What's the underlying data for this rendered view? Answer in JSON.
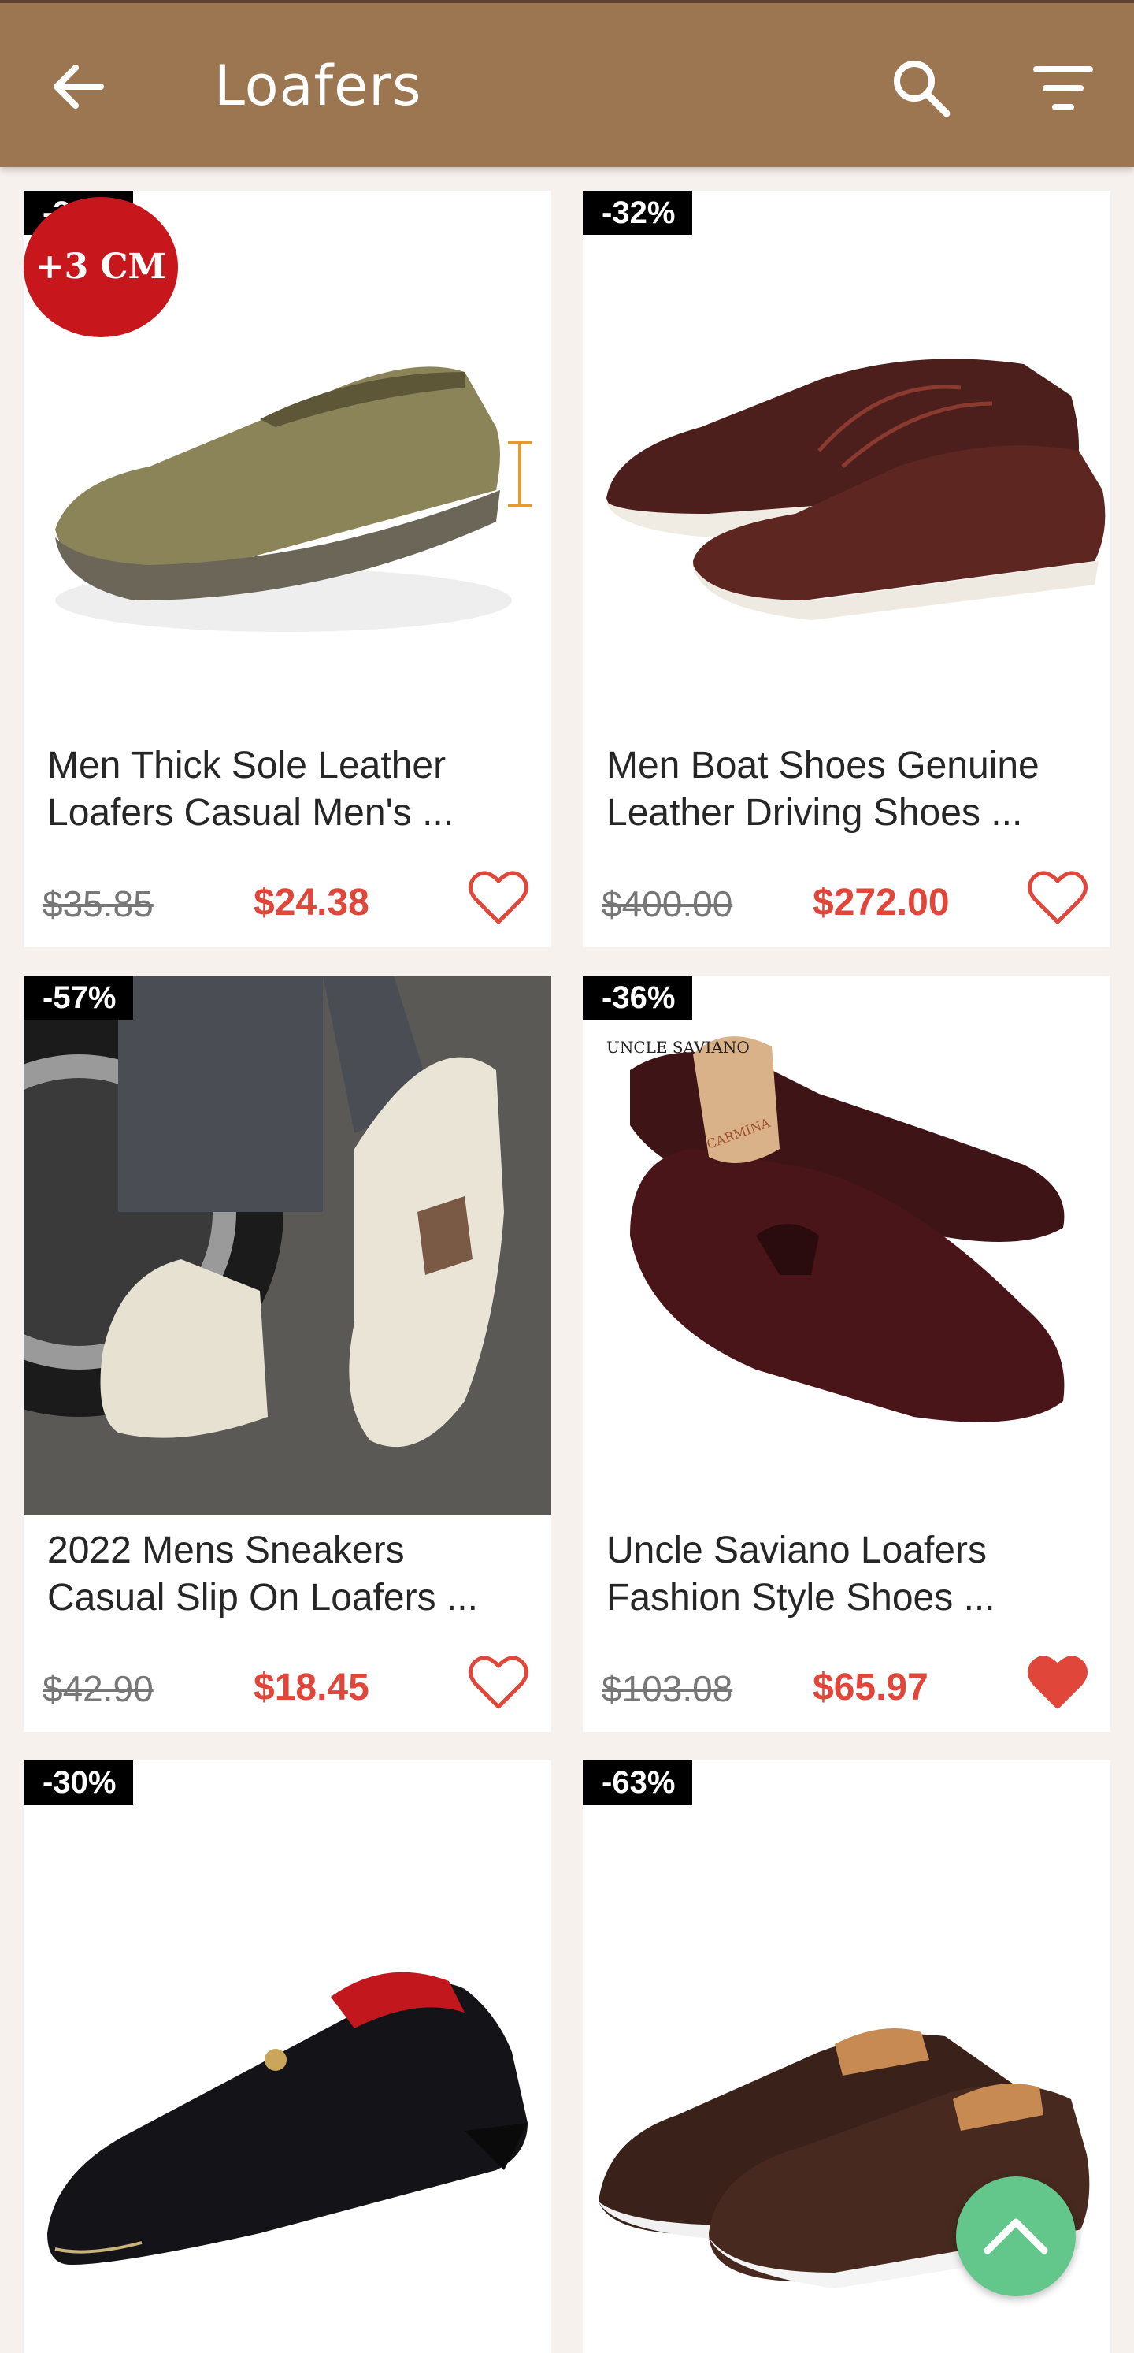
{
  "appbar": {
    "title": "Loafers",
    "back_icon": "arrow-left-icon",
    "search_icon": "search-icon",
    "filter_icon": "filter-icon",
    "color": "#9c7651"
  },
  "products": [
    {
      "discount": "-32%",
      "name_line1": "Men Thick Sole Leather",
      "name_line2": "Loafers Casual Men's ...",
      "old_price": "$35.85",
      "price": "$24.38",
      "favorite": false,
      "promo_badge": "+3 CM"
    },
    {
      "discount": "-32%",
      "name_line1": "Men Boat Shoes Genuine",
      "name_line2": "Leather Driving Shoes ...",
      "old_price": "$400.00",
      "price": "$272.00",
      "favorite": false
    },
    {
      "discount": "-57%",
      "name_line1": "2022 Mens Sneakers",
      "name_line2": "Casual Slip On Loafers ...",
      "old_price": "$42.90",
      "price": "$18.45",
      "favorite": false
    },
    {
      "discount": "-36%",
      "name_line1": "Uncle Saviano Loafers",
      "name_line2": "Fashion Style Shoes ...",
      "old_price": "$103.08",
      "price": "$65.97",
      "favorite": true,
      "image_logo": "UNCLE SAVIANO",
      "shoe_tree_text": "CARMINA"
    },
    {
      "discount": "-30%",
      "name_line1": "",
      "name_line2": "",
      "old_price": "",
      "price": "",
      "favorite": false
    },
    {
      "discount": "-63%",
      "name_line1": "",
      "name_line2": "",
      "old_price": "",
      "price": "",
      "favorite": false
    }
  ],
  "scroll_top_icon": "chevron-up-icon",
  "colors": {
    "price": "#e0463a",
    "heart": "#e0463a",
    "fab": "#63c68a",
    "background": "#f6f1ec"
  }
}
